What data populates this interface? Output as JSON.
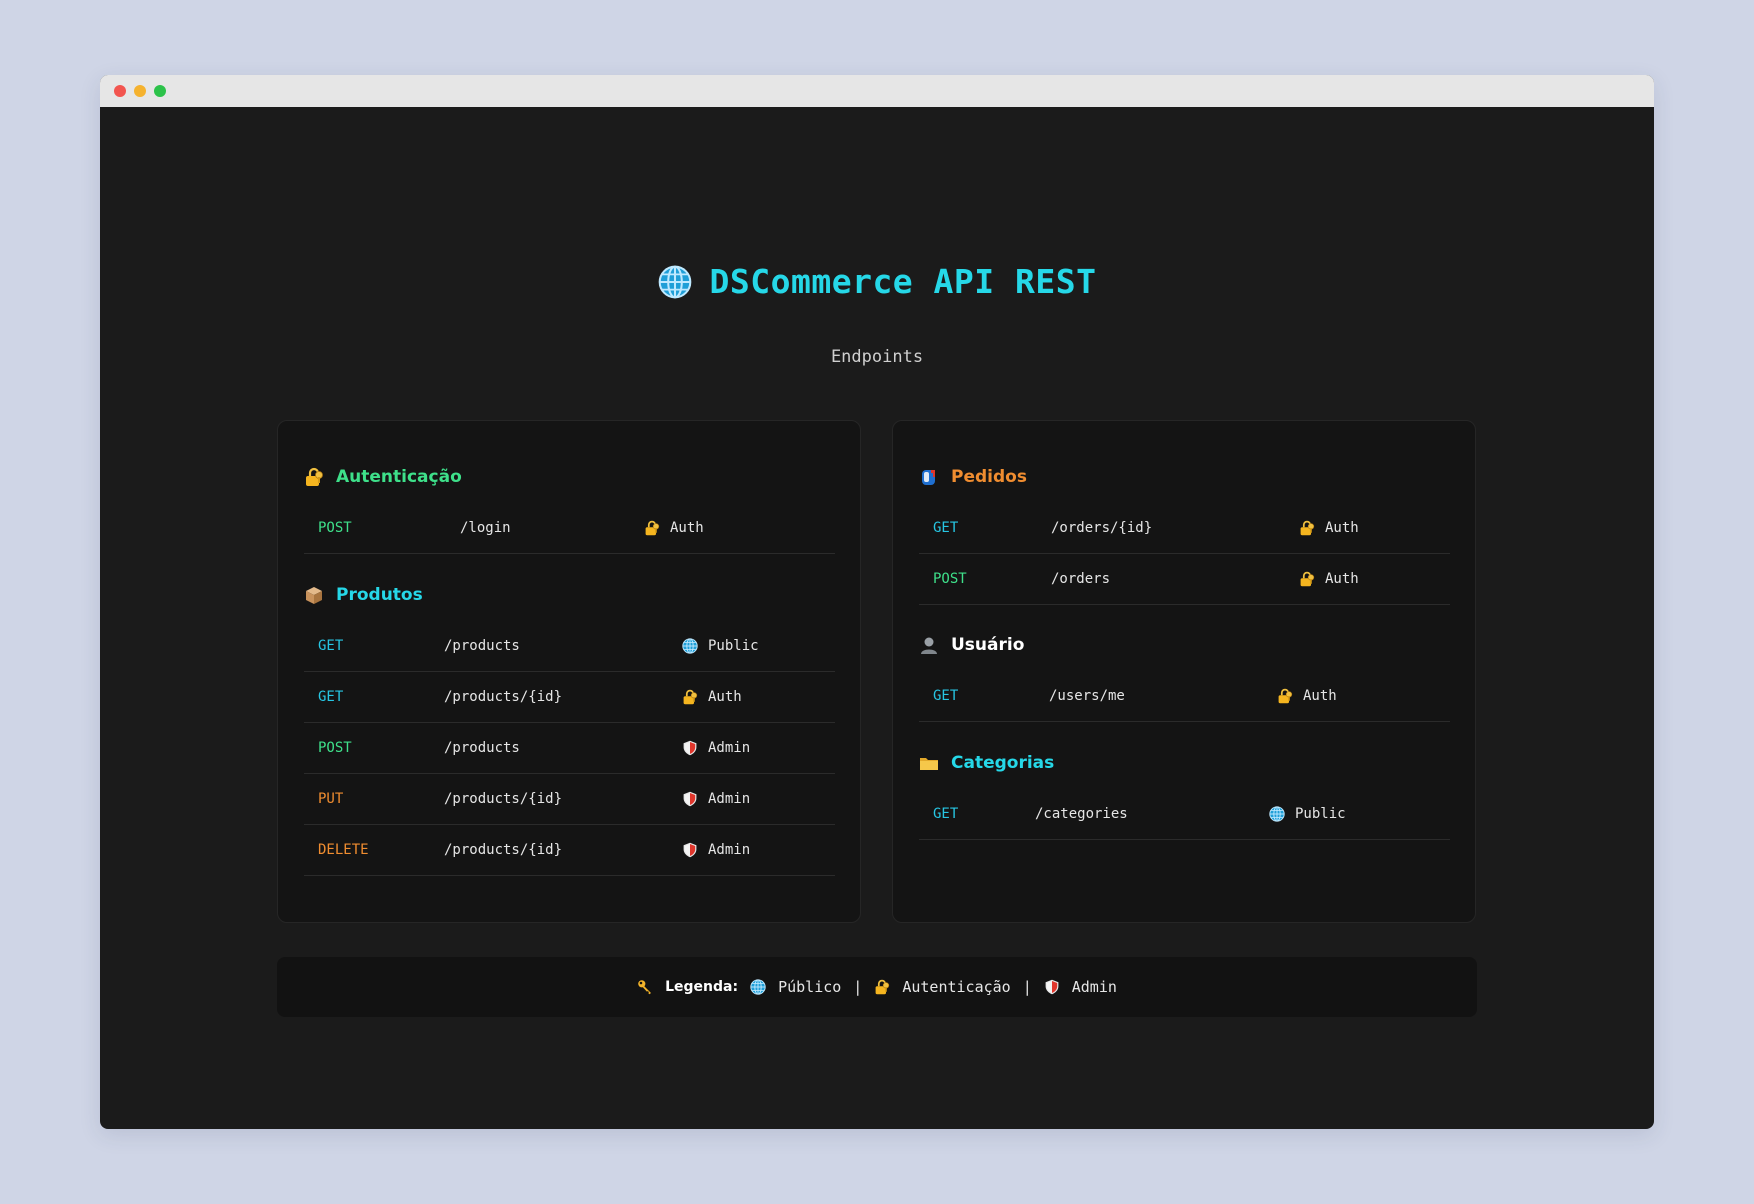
{
  "header": {
    "title": "DSCommerce API REST",
    "subtitle": "Endpoints"
  },
  "colors": {
    "accent": "#26d8e8",
    "get": "#27c6e3",
    "post": "#3ee08a",
    "put": "#f08d30",
    "delete": "#f08d30",
    "auth_heading": "#3ee08a",
    "orders_heading": "#f08d30"
  },
  "sections": {
    "auth": {
      "title": "Autenticação",
      "icon": "lock-icon",
      "rows": [
        {
          "method": "POST",
          "path": "/login",
          "access": "Auth",
          "access_icon": "lock-icon"
        }
      ]
    },
    "products": {
      "title": "Produtos",
      "icon": "package-icon",
      "rows": [
        {
          "method": "GET",
          "path": "/products",
          "access": "Public",
          "access_icon": "globe-icon"
        },
        {
          "method": "GET",
          "path": "/products/{id}",
          "access": "Auth",
          "access_icon": "lock-icon"
        },
        {
          "method": "POST",
          "path": "/products",
          "access": "Admin",
          "access_icon": "shield-icon"
        },
        {
          "method": "PUT",
          "path": "/products/{id}",
          "access": "Admin",
          "access_icon": "shield-icon"
        },
        {
          "method": "DELETE",
          "path": "/products/{id}",
          "access": "Admin",
          "access_icon": "shield-icon"
        }
      ]
    },
    "orders": {
      "title": "Pedidos",
      "icon": "mailbox-icon",
      "rows": [
        {
          "method": "GET",
          "path": "/orders/{id}",
          "access": "Auth",
          "access_icon": "lock-icon"
        },
        {
          "method": "POST",
          "path": "/orders",
          "access": "Auth",
          "access_icon": "lock-icon"
        }
      ]
    },
    "user": {
      "title": "Usuário",
      "icon": "user-icon",
      "rows": [
        {
          "method": "GET",
          "path": "/users/me",
          "access": "Auth",
          "access_icon": "lock-icon"
        }
      ]
    },
    "categories": {
      "title": "Categorias",
      "icon": "folder-icon",
      "rows": [
        {
          "method": "GET",
          "path": "/categories",
          "access": "Public",
          "access_icon": "globe-icon"
        }
      ]
    }
  },
  "legend": {
    "label": "Legenda:",
    "key_icon": "key-icon",
    "items": [
      {
        "label": "Público",
        "icon": "globe-icon"
      },
      {
        "label": "Autenticação",
        "icon": "lock-icon"
      },
      {
        "label": "Admin",
        "icon": "shield-icon"
      }
    ],
    "separator": "|"
  }
}
